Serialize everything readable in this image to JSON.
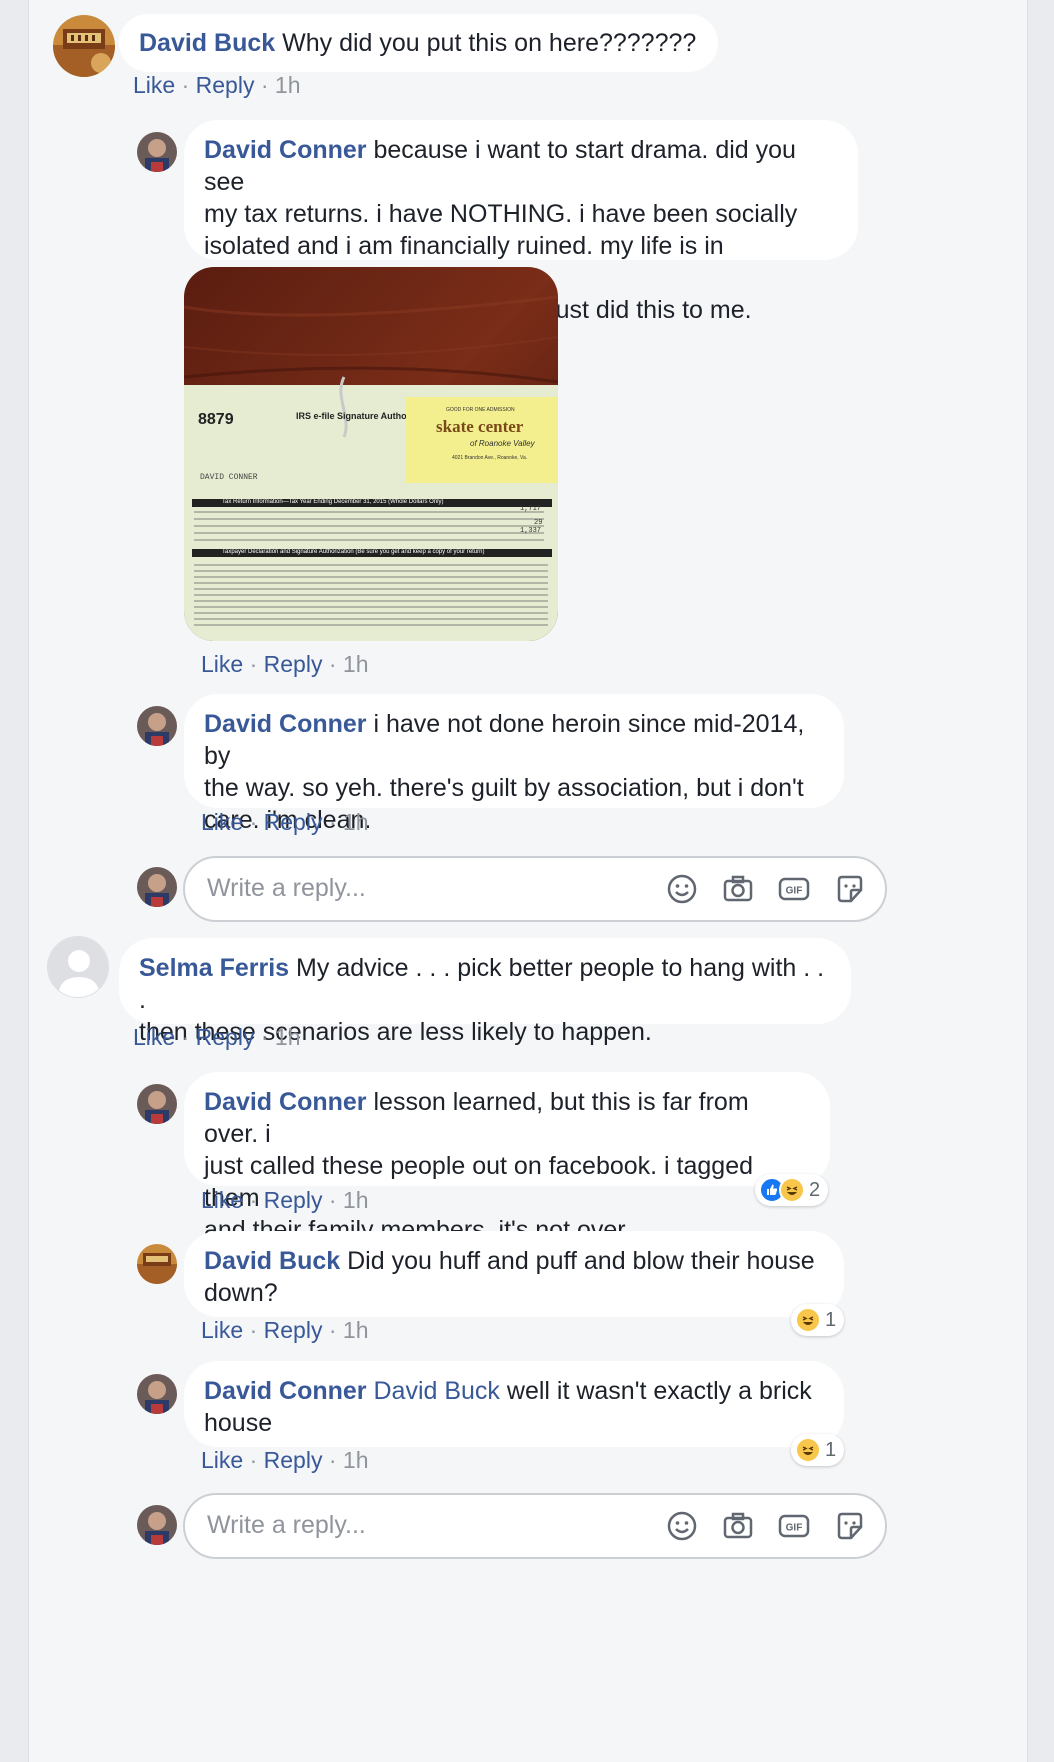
{
  "thread": {
    "actions": {
      "like": "Like",
      "reply": "Reply",
      "sep": "·"
    },
    "comments": [
      {
        "author": "David Buck",
        "text": "Why did you put this on here???????",
        "time": "1h"
      },
      {
        "author": "Selma Ferris",
        "text_line1": "My advice . . . pick better people to hang with . . .",
        "text_line2": "then these scenarios are less likely to happen.",
        "time": "1h"
      }
    ],
    "replies_1": [
      {
        "author": "David Conner",
        "text_line1": "because i want to start drama. did you see",
        "text_line2": "my tax returns. i have NOTHING. i have been socially",
        "text_line3": "isolated and i am financially ruined. my life is in shambles",
        "text_line4": "and these heroin dealing fucks just did this to me.",
        "time": "1h",
        "photo": {
          "form_number": "8879",
          "form_title": "IRS e-file Signature Author",
          "name_on_form": "DAVID CONNER",
          "ticket_header": "GOOD FOR ONE ADMISSION",
          "ticket_brand": "skate center",
          "ticket_sub": "of Roanoke Valley",
          "ticket_addr": "4021 Brandon Ave., Roanoke, Va.",
          "part1": "Tax Return Information—Tax Year Ending December 31, 2015 (Whole Dollars Only)",
          "part2": "Taxpayer Declaration and Signature Authorization (Be sure you get and keep a copy of your return)",
          "values": [
            "1,717",
            "29",
            "1,337"
          ]
        }
      },
      {
        "author": "David Conner",
        "text_line1": "i have not done heroin since mid-2014, by",
        "text_line2": "the way. so yeh. there's guilt by association, but i don't",
        "text_line3": "care. i'm clean.",
        "time": "1h"
      }
    ],
    "replies_2": [
      {
        "author": "David Conner",
        "text_line1": "lesson learned, but this is far from over. i",
        "text_line2": "just called these people out on facebook. i tagged them",
        "text_line3": "and their family members. it's not over.",
        "time": "1h",
        "reaction_count": "2"
      },
      {
        "author": "David Buck",
        "text_line1": "Did you huff and puff and blow their house",
        "text_line2": "down?",
        "time": "1h",
        "reaction_count": "1"
      },
      {
        "author": "David Conner",
        "mention": "David Buck",
        "text_line1": "well it wasn't exactly a brick",
        "text_line2": "house",
        "time": "1h",
        "reaction_count": "1"
      }
    ],
    "reply_box": {
      "placeholder": "Write a reply..."
    }
  }
}
